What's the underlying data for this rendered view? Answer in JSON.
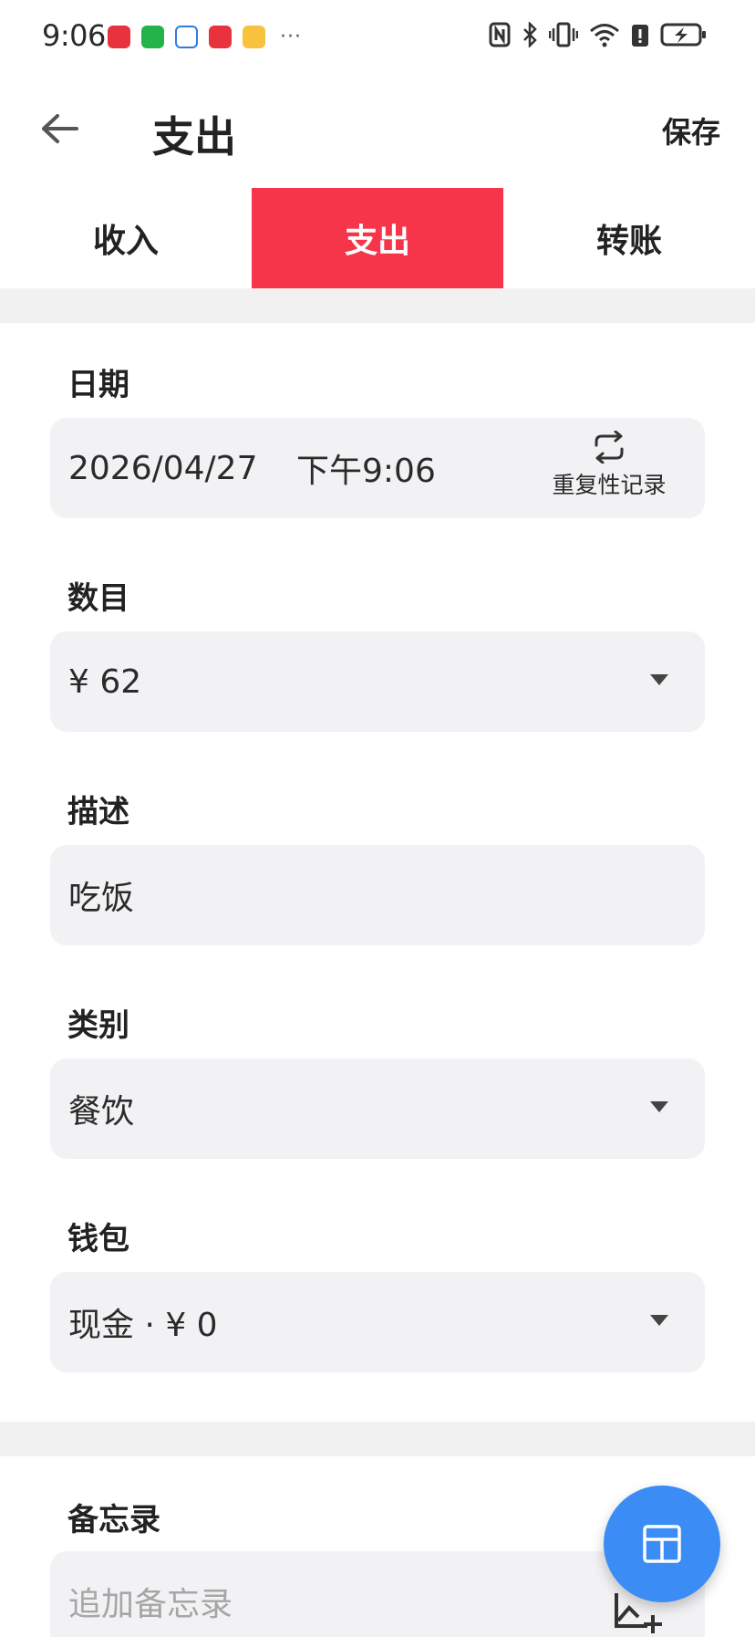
{
  "status_bar": {
    "time": "9:06",
    "more": "···",
    "notification_icons": [
      "xiaohongshu-icon",
      "wechat-icon",
      "baidu-netdisk-icon",
      "xiaohongshu-icon",
      "weibo-icon"
    ],
    "system_icons": [
      "nfc-icon",
      "bluetooth-icon",
      "vibrate-icon",
      "wifi-icon",
      "alert-icon",
      "battery-charging-icon"
    ]
  },
  "appbar": {
    "title": "支出",
    "save_label": "保存"
  },
  "tabs": [
    {
      "label": "收入",
      "active": false
    },
    {
      "label": "支出",
      "active": true
    },
    {
      "label": "转账",
      "active": false
    }
  ],
  "form": {
    "date": {
      "label": "日期",
      "date_value": "2026/04/27",
      "time_value": "下午9:06",
      "repeat_label": "重复性记录"
    },
    "amount": {
      "label": "数目",
      "value": "¥ 62"
    },
    "description": {
      "label": "描述",
      "value": "吃饭"
    },
    "category": {
      "label": "类别",
      "value": "餐饮"
    },
    "wallet": {
      "label": "钱包",
      "value": "现金 · ¥ 0"
    },
    "memo": {
      "label": "备忘录",
      "placeholder": "追加备忘录"
    }
  },
  "colors": {
    "accent_red": "#f7354a",
    "fab_blue": "#3b8cf5",
    "field_bg": "#f2f2f4"
  }
}
